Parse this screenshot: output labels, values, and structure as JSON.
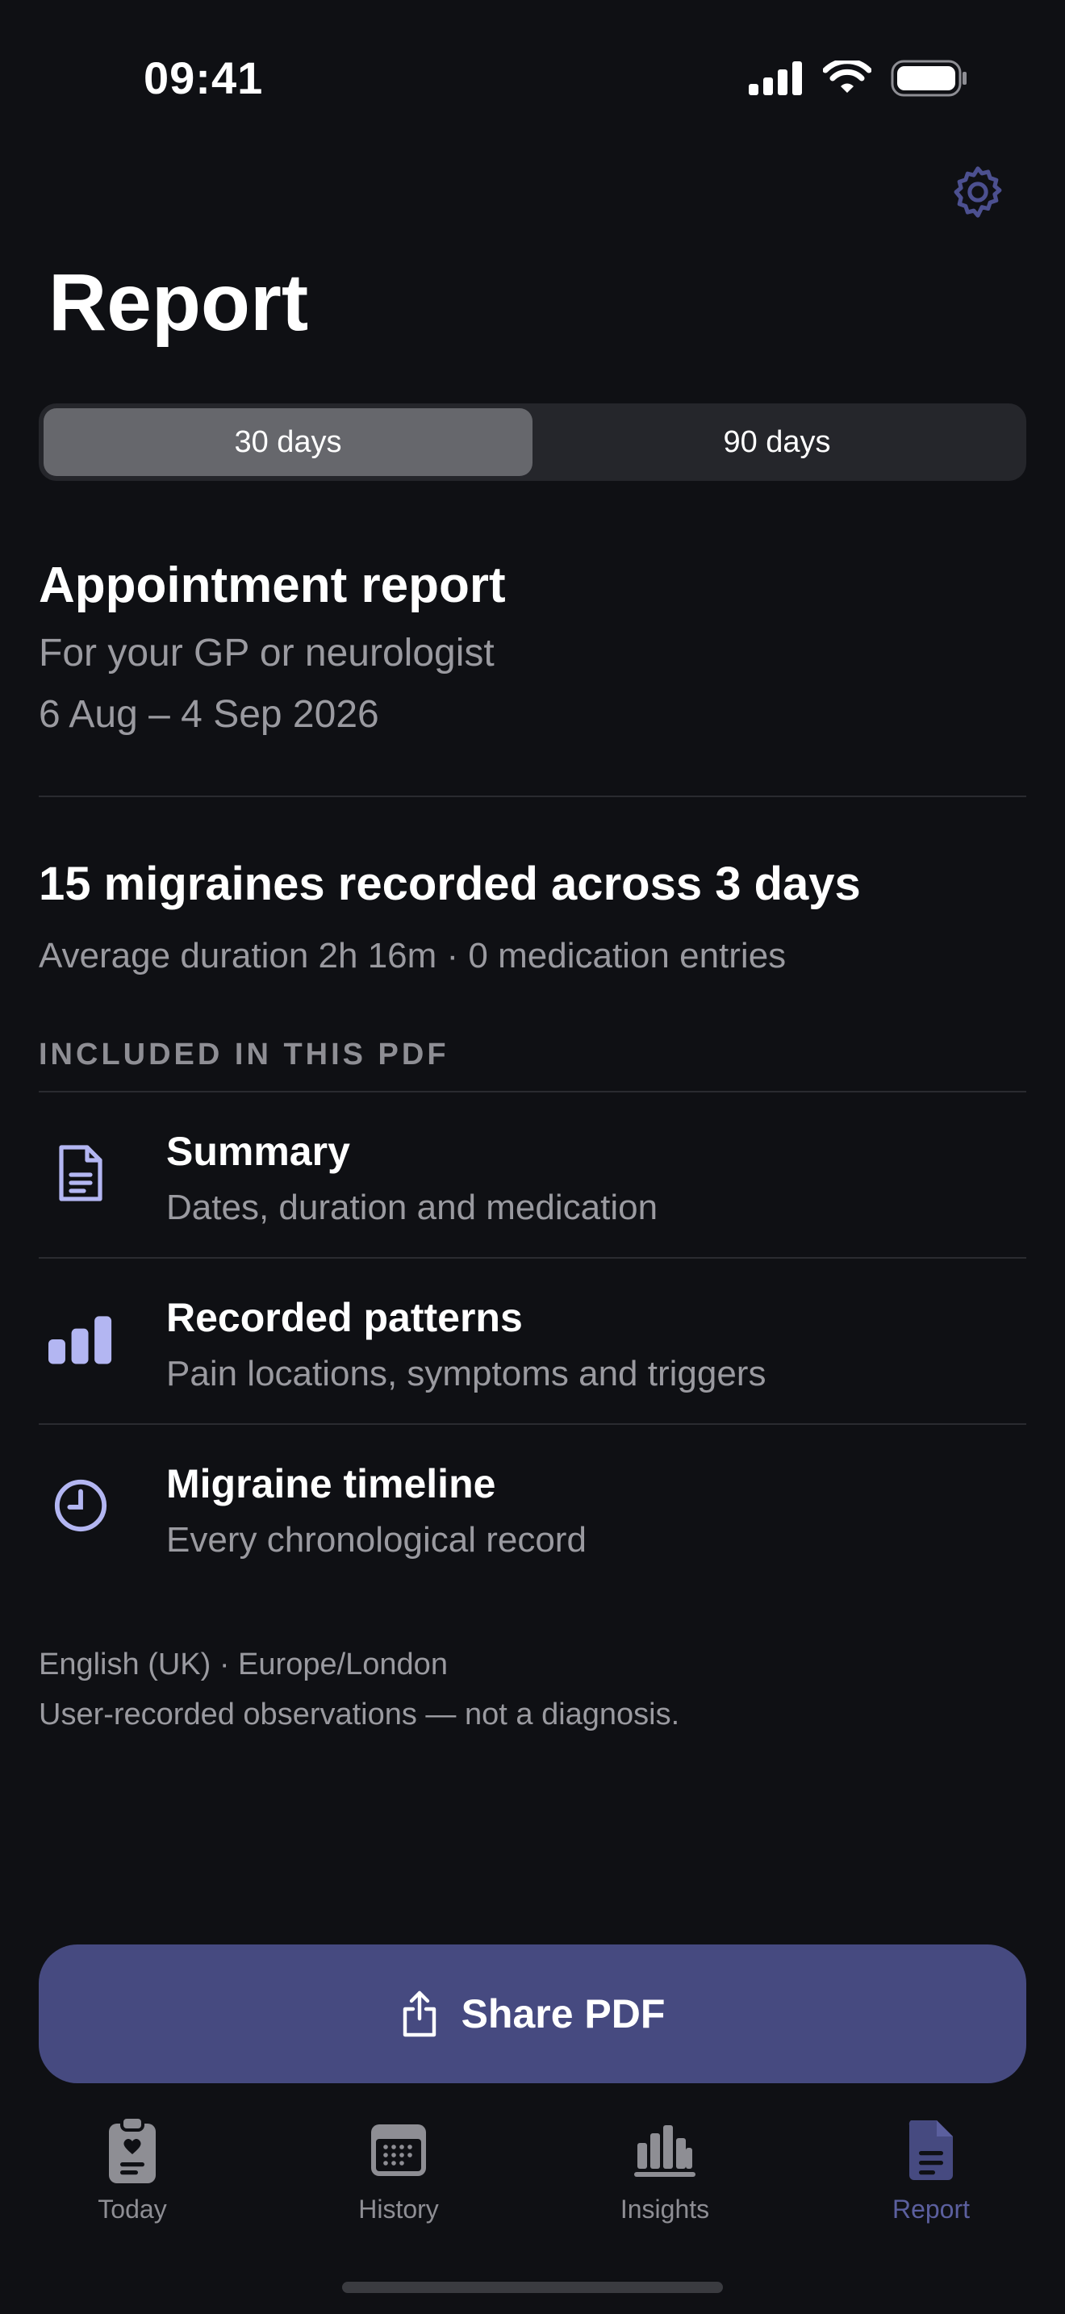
{
  "status_bar": {
    "time": "09:41"
  },
  "header": {
    "title": "Report",
    "settings_icon": "gear-icon"
  },
  "range_selector": {
    "options": [
      "30 days",
      "90 days"
    ],
    "selected": "30 days"
  },
  "report": {
    "title": "Appointment report",
    "subtitle": "For your GP or neurologist",
    "date_range": "6 Aug – 4 Sep 2026"
  },
  "stats": {
    "headline": "15 migraines recorded across 3 days",
    "detail": "Average duration 2h 16m · 0 medication entries"
  },
  "included": {
    "heading": "INCLUDED IN THIS PDF",
    "items": [
      {
        "title": "Summary",
        "subtitle": "Dates, duration and medication",
        "icon": "document-icon"
      },
      {
        "title": "Recorded patterns",
        "subtitle": "Pain locations, symptoms and triggers",
        "icon": "bar-chart-icon"
      },
      {
        "title": "Migraine timeline",
        "subtitle": "Every chronological record",
        "icon": "clock-icon"
      }
    ]
  },
  "footer": {
    "locale": "English (UK) · Europe/London",
    "disclaimer": "User-recorded observations — not a diagnosis."
  },
  "share_button": {
    "label": "Share PDF",
    "icon": "share-icon"
  },
  "tab_bar": {
    "tabs": [
      {
        "label": "Today",
        "icon": "clipboard-heart-icon"
      },
      {
        "label": "History",
        "icon": "calendar-icon"
      },
      {
        "label": "Insights",
        "icon": "chart-icon"
      },
      {
        "label": "Report",
        "icon": "document-icon"
      }
    ],
    "active": "Report"
  },
  "colors": {
    "background": "#0f1014",
    "accent": "#464a80",
    "icon_accent": "#b3b6f2",
    "muted_text": "#9a9aa0",
    "active_tab": "#5b5f9e"
  }
}
